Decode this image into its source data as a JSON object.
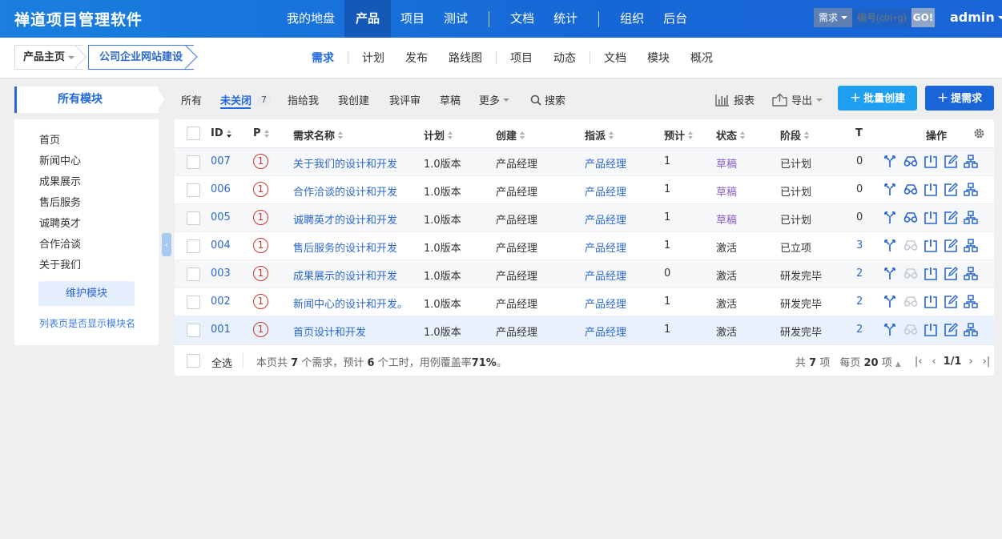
{
  "header": {
    "app_title": "禅道项目管理软件",
    "nav": [
      "我的地盘",
      "产品",
      "项目",
      "测试",
      "文档",
      "统计",
      "组织",
      "后台"
    ],
    "active_nav": "产品",
    "search_type": "需求",
    "search_placeholder": "编号(ctrl+g)",
    "search_go": "GO!",
    "user": "admin"
  },
  "subheader": {
    "crumb_product": "产品主页",
    "crumb_project": "公司企业网站建设",
    "nav": [
      "需求",
      "计划",
      "发布",
      "路线图",
      "项目",
      "动态",
      "文档",
      "模块",
      "概况"
    ],
    "active_nav": "需求"
  },
  "sidebar": {
    "title": "所有模块",
    "modules": [
      "首页",
      "新闻中心",
      "成果展示",
      "售后服务",
      "诚聘英才",
      "合作洽谈",
      "关于我们"
    ],
    "maintain_button": "维护模块",
    "show_module_link": "列表页是否显示模块名"
  },
  "filters": {
    "all": "所有",
    "open": "未关闭",
    "open_count": "7",
    "assigned_to_me": "指给我",
    "created_by_me": "我创建",
    "reviewed_by_me": "我评审",
    "draft": "草稿",
    "more": "更多",
    "search": "搜索",
    "report": "报表",
    "export": "导出",
    "batch_create": "批量创建",
    "create": "提需求"
  },
  "table": {
    "headers": {
      "id": "ID",
      "pri": "P",
      "title": "需求名称",
      "plan": "计划",
      "opened_by": "创建",
      "assigned_to": "指派",
      "estimate": "预计",
      "status": "状态",
      "stage": "阶段",
      "t": "T",
      "actions": "操作"
    },
    "rows": [
      {
        "id": "007",
        "pri": "1",
        "title": "关于我们的设计和开发",
        "plan": "1.0版本",
        "opened_by": "产品经理",
        "assigned_to": "产品经理",
        "estimate": "1",
        "status": "草稿",
        "stage": "已计划",
        "t": "0"
      },
      {
        "id": "006",
        "pri": "1",
        "title": "合作洽谈的设计和开发",
        "plan": "1.0版本",
        "opened_by": "产品经理",
        "assigned_to": "产品经理",
        "estimate": "1",
        "status": "草稿",
        "stage": "已计划",
        "t": "0"
      },
      {
        "id": "005",
        "pri": "1",
        "title": "诚聘英才的设计和开发",
        "plan": "1.0版本",
        "opened_by": "产品经理",
        "assigned_to": "产品经理",
        "estimate": "1",
        "status": "草稿",
        "stage": "已计划",
        "t": "0"
      },
      {
        "id": "004",
        "pri": "1",
        "title": "售后服务的设计和开发",
        "plan": "1.0版本",
        "opened_by": "产品经理",
        "assigned_to": "产品经理",
        "estimate": "1",
        "status": "激活",
        "stage": "已立项",
        "t": "3"
      },
      {
        "id": "003",
        "pri": "1",
        "title": "成果展示的设计和开发",
        "plan": "1.0版本",
        "opened_by": "产品经理",
        "assigned_to": "产品经理",
        "estimate": "0",
        "status": "激活",
        "stage": "研发完毕",
        "t": "2"
      },
      {
        "id": "002",
        "pri": "1",
        "title": "新闻中心的设计和开发。",
        "plan": "1.0版本",
        "opened_by": "产品经理",
        "assigned_to": "产品经理",
        "estimate": "1",
        "status": "激活",
        "stage": "研发完毕",
        "t": "2"
      },
      {
        "id": "001",
        "pri": "1",
        "title": "首页设计和开发",
        "plan": "1.0版本",
        "opened_by": "产品经理",
        "assigned_to": "产品经理",
        "estimate": "1",
        "status": "激活",
        "stage": "研发完毕",
        "t": "2"
      }
    ],
    "footer": {
      "select_all": "全选",
      "summary_prefix": "本页共",
      "summary_count": "7",
      "summary_mid": "个需求，预计",
      "summary_hours": "6",
      "summary_mid2": "个工时，用例覆盖率",
      "summary_rate": "71%",
      "summary_suffix": "。",
      "total_prefix": "共",
      "total_count": "7",
      "total_suffix": "项",
      "per_page_prefix": "每页",
      "per_page": "20",
      "per_page_suffix": "项",
      "page": "1/1"
    }
  },
  "icons": [
    "caret-down-icon",
    "search-icon",
    "report-icon",
    "export-icon",
    "plus-icon",
    "settings-icon",
    "split-icon",
    "review-icon",
    "close-icon",
    "edit-icon",
    "create-case-icon",
    "collapse-left-icon",
    "first-page-icon",
    "prev-page-icon",
    "next-page-icon",
    "last-page-icon"
  ],
  "colors": {
    "brand": "#1a66d8",
    "link": "#2c67cf",
    "priority": "#d0342c",
    "draft": "#8a5ec9",
    "batch_button": "#1e9ff2"
  }
}
